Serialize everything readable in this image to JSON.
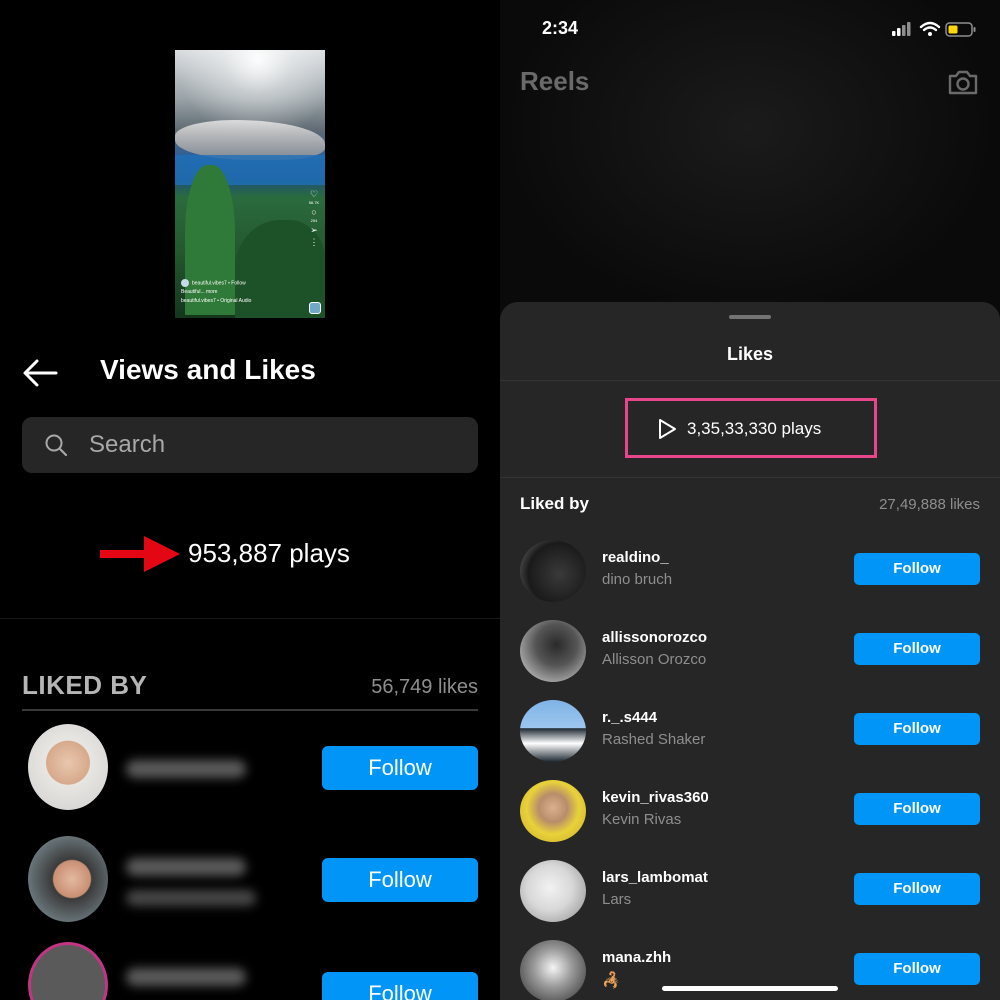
{
  "left_screen": {
    "thumbnail": {
      "username": "beautiful.vibes7 • Follow",
      "caption": "Beautiful... more",
      "audio": "beautiful.vibes7 • Original Audio",
      "like_count": "56.7K",
      "comment_count": "254"
    },
    "title": "Views and Likes",
    "search_placeholder": "Search",
    "plays": "953,887 plays",
    "liked_by_label": "LIKED BY",
    "likes_count": "56,749 likes",
    "follow_label": "Follow",
    "arrow_color": "#e30613"
  },
  "right_screen": {
    "status_time": "2:34",
    "header_title": "Reels",
    "sheet_title": "Likes",
    "plays": "3,35,33,330 plays",
    "liked_by_label": "Liked by",
    "likes_count": "27,49,888 likes",
    "follow_label": "Follow",
    "highlight_color": "#e8458b",
    "button_color": "#0095f6",
    "users": [
      {
        "username": "realdino_",
        "name": "dino bruch"
      },
      {
        "username": "allissonorozco",
        "name": "Allisson Orozco"
      },
      {
        "username": "r._.s444",
        "name": "Rashed Shaker"
      },
      {
        "username": "kevin_rivas360",
        "name": "Kevin Rivas"
      },
      {
        "username": "lars_lambomat",
        "name": "Lars"
      },
      {
        "username": "mana.zhh",
        "name": "🦂"
      }
    ]
  }
}
